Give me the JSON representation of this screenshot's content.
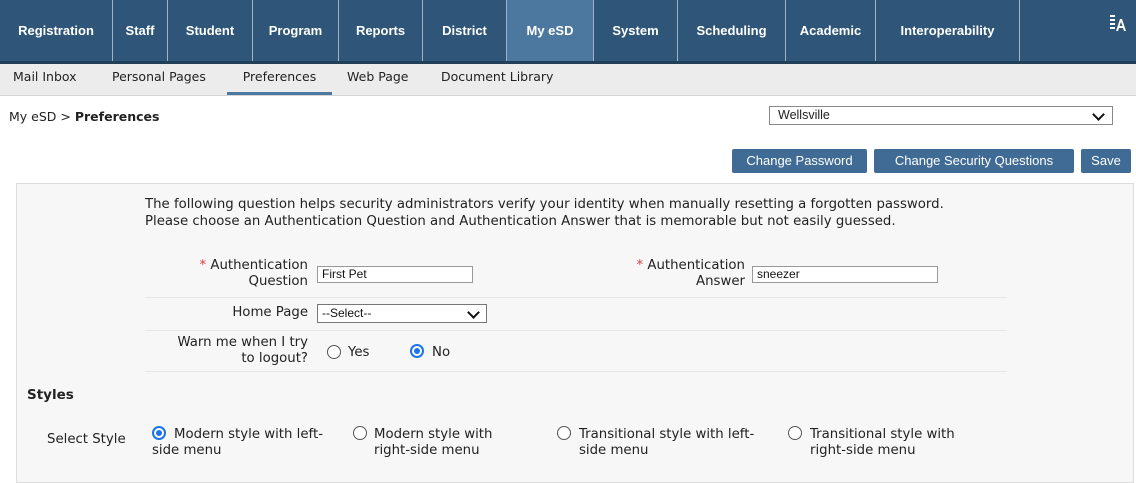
{
  "nav": {
    "top_items": [
      {
        "label": "Registration",
        "active": false
      },
      {
        "label": "Staff",
        "active": false
      },
      {
        "label": "Student",
        "active": false
      },
      {
        "label": "Program",
        "active": false
      },
      {
        "label": "Reports",
        "active": false
      },
      {
        "label": "District",
        "active": false
      },
      {
        "label": "My eSD",
        "active": true
      },
      {
        "label": "System",
        "active": false
      },
      {
        "label": "Scheduling",
        "active": false
      },
      {
        "label": "Academic",
        "active": false
      },
      {
        "label": "Interoperability",
        "active": false
      }
    ],
    "sub_items": [
      {
        "label": "Mail Inbox",
        "active": false
      },
      {
        "label": "Personal Pages",
        "active": false
      },
      {
        "label": "Preferences",
        "active": true
      },
      {
        "label": "Web Page",
        "active": false
      },
      {
        "label": "Document Library",
        "active": false
      }
    ],
    "font_icon": "font-size-icon"
  },
  "breadcrumb": {
    "parent": "My eSD",
    "separator": ">",
    "current": "Preferences"
  },
  "site_select": {
    "value": "Wellsville"
  },
  "buttons": {
    "change_password": "Change Password",
    "change_security": "Change Security Questions",
    "save": "Save"
  },
  "form": {
    "intro": "The following question helps security administrators verify your identity when manually resetting a forgotten password. Please choose an Authentication Question and Authentication Answer that is memorable but not easily guessed.",
    "required_mark": "*",
    "auth_question_label": [
      "Authentication",
      "Question"
    ],
    "auth_question_value": "First Pet",
    "auth_answer_label": [
      "Authentication",
      "Answer"
    ],
    "auth_answer_value": "sneezer",
    "home_page_label": "Home Page",
    "home_page_value": "--Select--",
    "warn_label": [
      "Warn me when I try",
      "to logout?"
    ],
    "warn_yes": "Yes",
    "warn_no": "No",
    "warn_selected": "No"
  },
  "styles": {
    "heading": "Styles",
    "select_label": "Select Style",
    "options": [
      {
        "lines": [
          "Modern style with left-",
          "side menu"
        ],
        "selected": true
      },
      {
        "lines": [
          "Modern style with",
          "right-side menu"
        ],
        "selected": false
      },
      {
        "lines": [
          "Transitional style with left-",
          "side menu"
        ],
        "selected": false
      },
      {
        "lines": [
          "Transitional style with",
          "right-side menu"
        ],
        "selected": false
      }
    ]
  }
}
